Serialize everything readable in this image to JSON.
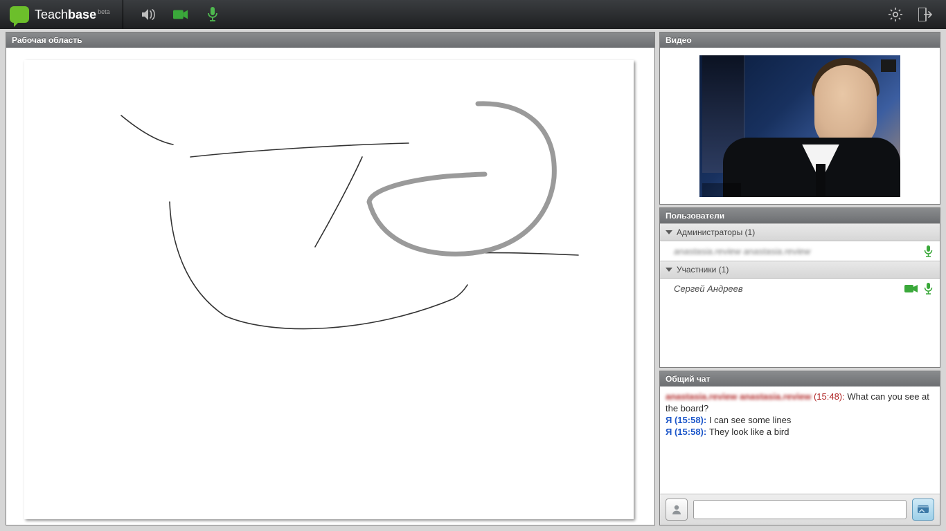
{
  "brand": {
    "name_light": "Teach",
    "name_bold": "base",
    "beta": "beta"
  },
  "workspace": {
    "title": "Рабочая область"
  },
  "video": {
    "title": "Видео"
  },
  "users": {
    "title": "Пользователи",
    "admins_label": "Администраторы (1)",
    "participants_label": "Участники (1)",
    "admin_name": "anastasia.review anastasia.review",
    "participant_name": "Сергей Андреев"
  },
  "chat": {
    "title": "Общий чат",
    "input_value": "",
    "messages": [
      {
        "who": "anastasia.review anastasia.review",
        "time": "(15:48):",
        "text": "What can you see at the board?",
        "kind": "admin"
      },
      {
        "who": "Я",
        "time": "(15:58):",
        "text": "I can see some lines",
        "kind": "self"
      },
      {
        "who": "Я",
        "time": "(15:58):",
        "text": "They look like a bird",
        "kind": "self"
      }
    ]
  },
  "colors": {
    "green": "#3aa83a",
    "mic_green": "#4fb84f"
  }
}
